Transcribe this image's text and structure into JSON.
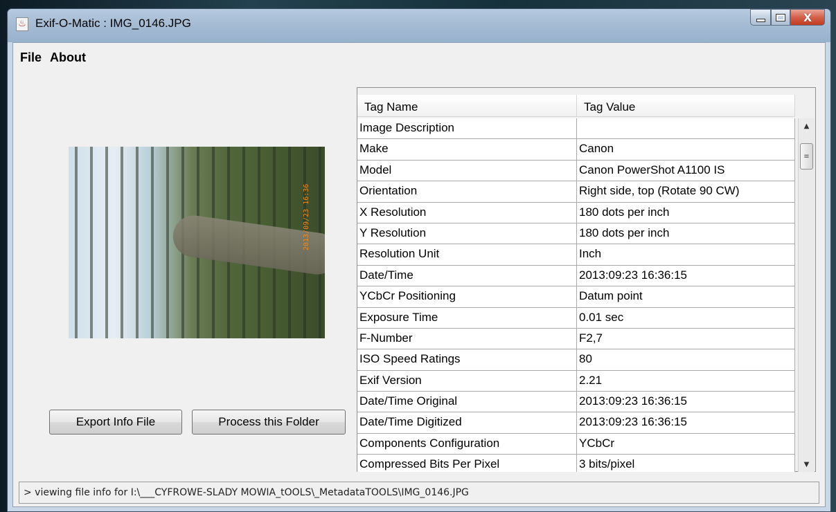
{
  "window": {
    "title": "Exif-O-Matic : IMG_0146.JPG"
  },
  "menu": [
    "File",
    "About"
  ],
  "photo": {
    "timestamp": "2013/09/23 16:36"
  },
  "buttons": {
    "export": "Export Info File",
    "process": "Process this Folder"
  },
  "table": {
    "columns": [
      "Tag Name",
      "Tag Value"
    ],
    "rows": [
      [
        "Image Description",
        ""
      ],
      [
        "Make",
        "Canon"
      ],
      [
        "Model",
        "Canon PowerShot A1100 IS"
      ],
      [
        "Orientation",
        "Right side, top (Rotate 90 CW)"
      ],
      [
        "X Resolution",
        "180 dots per inch"
      ],
      [
        "Y Resolution",
        "180 dots per inch"
      ],
      [
        "Resolution Unit",
        "Inch"
      ],
      [
        "Date/Time",
        "2013:09:23 16:36:15"
      ],
      [
        "YCbCr Positioning",
        "Datum point"
      ],
      [
        "Exposure Time",
        "0.01 sec"
      ],
      [
        "F-Number",
        "F2,7"
      ],
      [
        "ISO Speed Ratings",
        "80"
      ],
      [
        "Exif Version",
        "2.21"
      ],
      [
        "Date/Time Original",
        "2013:09:23 16:36:15"
      ],
      [
        "Date/Time Digitized",
        "2013:09:23 16:36:15"
      ],
      [
        "Components Configuration",
        "YCbCr"
      ],
      [
        "Compressed Bits Per Pixel",
        "3 bits/pixel"
      ]
    ]
  },
  "status": "> viewing file info for I:\\___CYFROWE-SLADY MOWIA_tOOLS\\_MetadataTOOLS\\IMG_0146.JPG"
}
